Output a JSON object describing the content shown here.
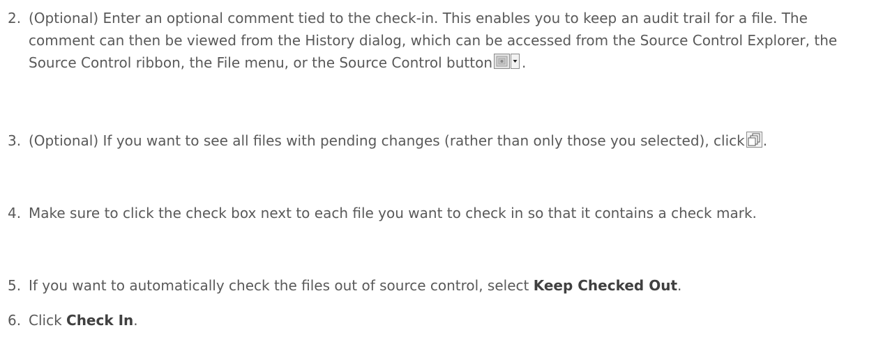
{
  "steps": [
    {
      "number": "2.",
      "text": "(Optional) Enter an optional comment tied to the check-in. This enables you to keep an audit trail for a file. The comment can then be viewed from the History dialog, which can be accessed from the Source Control Explorer, the Source Control ribbon, the File menu, or the Source Control button",
      "end": ".",
      "icon": "source-control-button-icon"
    },
    {
      "number": "3.",
      "text": "(Optional) If you want to see all files with pending changes (rather than only those you selected), click",
      "end": ".",
      "icon": "show-all-pending-files-icon"
    },
    {
      "number": "4.",
      "text": "Make sure to click the check box next to each file you want to check in so that it contains a check mark."
    },
    {
      "number": "5.",
      "text": "If you want to automatically check the files out of source control, select",
      "bold": "Keep Checked Out",
      "end": "."
    },
    {
      "number": "6.",
      "text": "Click",
      "bold": "Check In",
      "end": "."
    }
  ]
}
